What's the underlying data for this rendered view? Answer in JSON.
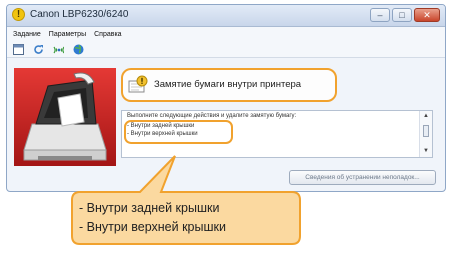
{
  "window": {
    "title": "Canon LBP6230/6240",
    "controls": {
      "minimize": "–",
      "maximize": "□",
      "close": "✕"
    }
  },
  "menu": {
    "items": [
      "Задание",
      "Параметры",
      "Справка"
    ]
  },
  "toolbar": {
    "icons": [
      "window-icon",
      "refresh-icon",
      "network-icon",
      "web-icon"
    ]
  },
  "status": {
    "text": "Замятие бумаги внутри принтера",
    "icon": "paper-jam-warning-icon"
  },
  "message": {
    "header": "Выполните следующие действия и удалите замятую бумагу:",
    "lines": [
      "- Внутри задней крышки",
      "- Внутри верхней крышки"
    ]
  },
  "help_button": {
    "label": "Сведения об устранении неполадок..."
  },
  "callout": {
    "lines": [
      "- Внутри задней крышки",
      "- Внутри верхней крышки"
    ]
  },
  "colors": {
    "highlight": "#f1a22e",
    "callout_fill": "#fbd9a0",
    "printer_bg": "#c62828"
  }
}
